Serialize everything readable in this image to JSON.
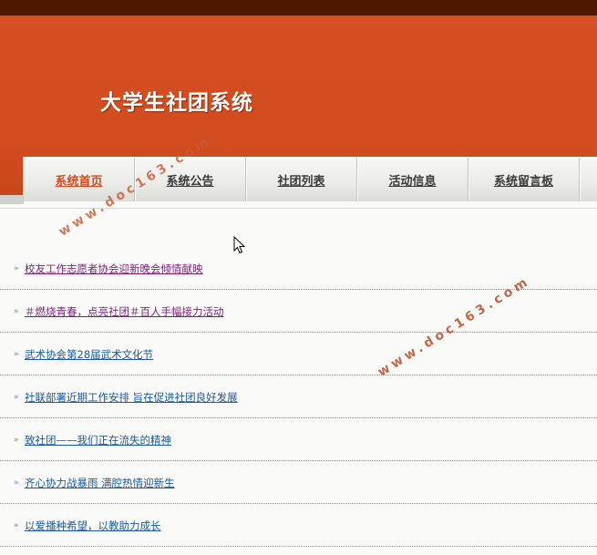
{
  "header": {
    "site_title": "大学生社团系统"
  },
  "nav": {
    "items": [
      {
        "label": "系统首页",
        "active": true
      },
      {
        "label": "系统公告",
        "active": false
      },
      {
        "label": "社团列表",
        "active": false
      },
      {
        "label": "活动信息",
        "active": false
      },
      {
        "label": "系统留言板",
        "active": false
      }
    ]
  },
  "news": {
    "items": [
      {
        "title": "校友工作志愿者协会迎新晚会倾情献映",
        "visited": true
      },
      {
        "title": "＃燃烧青春，点亮社团＃百人手幅接力活动",
        "visited": true
      },
      {
        "title": "武术协会第28届武术文化节",
        "visited": false
      },
      {
        "title": "社联部署近期工作安排 旨在促进社团良好发展",
        "visited": false
      },
      {
        "title": "致社团——我们正在流失的精神",
        "visited": false
      },
      {
        "title": "齐心协力战暴雨 满腔热情迎新生",
        "visited": false
      },
      {
        "title": "以爱播种希望，以教助力成长",
        "visited": false
      }
    ],
    "bullet_glyph": "»"
  },
  "watermark": {
    "text": "www.doc163.com"
  },
  "colors": {
    "banner": "#d64f22",
    "top_strip": "#4e1700",
    "active_nav": "#d24c20",
    "link": "#1a5a9a",
    "visited_link": "#7b1f7b"
  }
}
